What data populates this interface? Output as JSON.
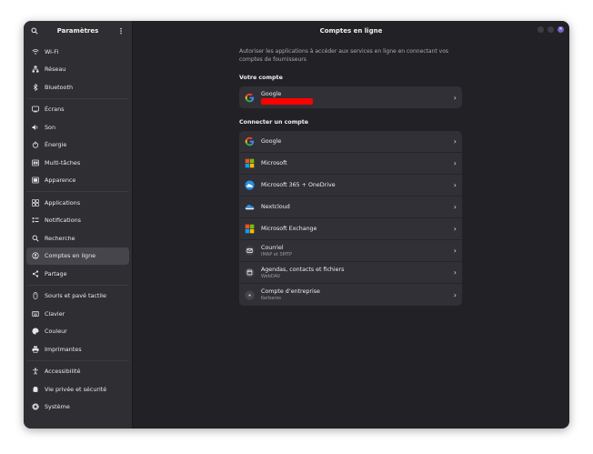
{
  "sidebar": {
    "title": "Paramètres",
    "groups": [
      [
        {
          "label": "Wi-Fi",
          "icon": "wifi-icon"
        },
        {
          "label": "Réseau",
          "icon": "network-icon"
        },
        {
          "label": "Bluetooth",
          "icon": "bluetooth-icon"
        }
      ],
      [
        {
          "label": "Écrans",
          "icon": "display-icon"
        },
        {
          "label": "Son",
          "icon": "sound-icon"
        },
        {
          "label": "Énergie",
          "icon": "power-icon"
        },
        {
          "label": "Multi-tâches",
          "icon": "multitasking-icon"
        },
        {
          "label": "Apparence",
          "icon": "appearance-icon"
        }
      ],
      [
        {
          "label": "Applications",
          "icon": "apps-icon"
        },
        {
          "label": "Notifications",
          "icon": "notifications-icon"
        },
        {
          "label": "Recherche",
          "icon": "search-icon"
        },
        {
          "label": "Comptes en ligne",
          "icon": "online-accounts-icon",
          "active": true
        },
        {
          "label": "Partage",
          "icon": "share-icon"
        }
      ],
      [
        {
          "label": "Souris et pavé tactile",
          "icon": "mouse-icon"
        },
        {
          "label": "Clavier",
          "icon": "keyboard-icon"
        },
        {
          "label": "Couleur",
          "icon": "color-icon"
        },
        {
          "label": "Imprimantes",
          "icon": "printer-icon"
        }
      ],
      [
        {
          "label": "Accessibilité",
          "icon": "accessibility-icon"
        },
        {
          "label": "Vie privée et sécurité",
          "icon": "privacy-icon"
        },
        {
          "label": "Système",
          "icon": "system-icon"
        }
      ]
    ]
  },
  "main": {
    "title": "Comptes en ligne",
    "description": "Autoriser les applications à accéder aux services en ligne en connectant vos comptes de fournisseurs",
    "your_account": {
      "title": "Votre compte",
      "account": {
        "provider": "Google"
      }
    },
    "connect": {
      "title": "Connecter un compte",
      "providers": [
        {
          "label": "Google",
          "icon": "google-icon"
        },
        {
          "label": "Microsoft",
          "icon": "microsoft-icon"
        },
        {
          "label": "Microsoft 365 + OneDrive",
          "icon": "onedrive-icon"
        },
        {
          "label": "Nextcloud",
          "icon": "nextcloud-icon"
        },
        {
          "label": "Microsoft Exchange",
          "icon": "exchange-icon"
        },
        {
          "label": "Courriel",
          "sub": "IMAP et SMTP",
          "icon": "mail-icon"
        },
        {
          "label": "Agendas, contacts et fichiers",
          "sub": "WebDAV",
          "icon": "webdav-icon"
        },
        {
          "label": "Compte d’entreprise",
          "sub": "Kerberos",
          "icon": "kerberos-icon"
        }
      ]
    }
  },
  "colors": {
    "accent": "#7b5fc7",
    "sidebar_bg": "#2e2e33",
    "main_bg": "#222226",
    "card_bg": "#303036"
  }
}
